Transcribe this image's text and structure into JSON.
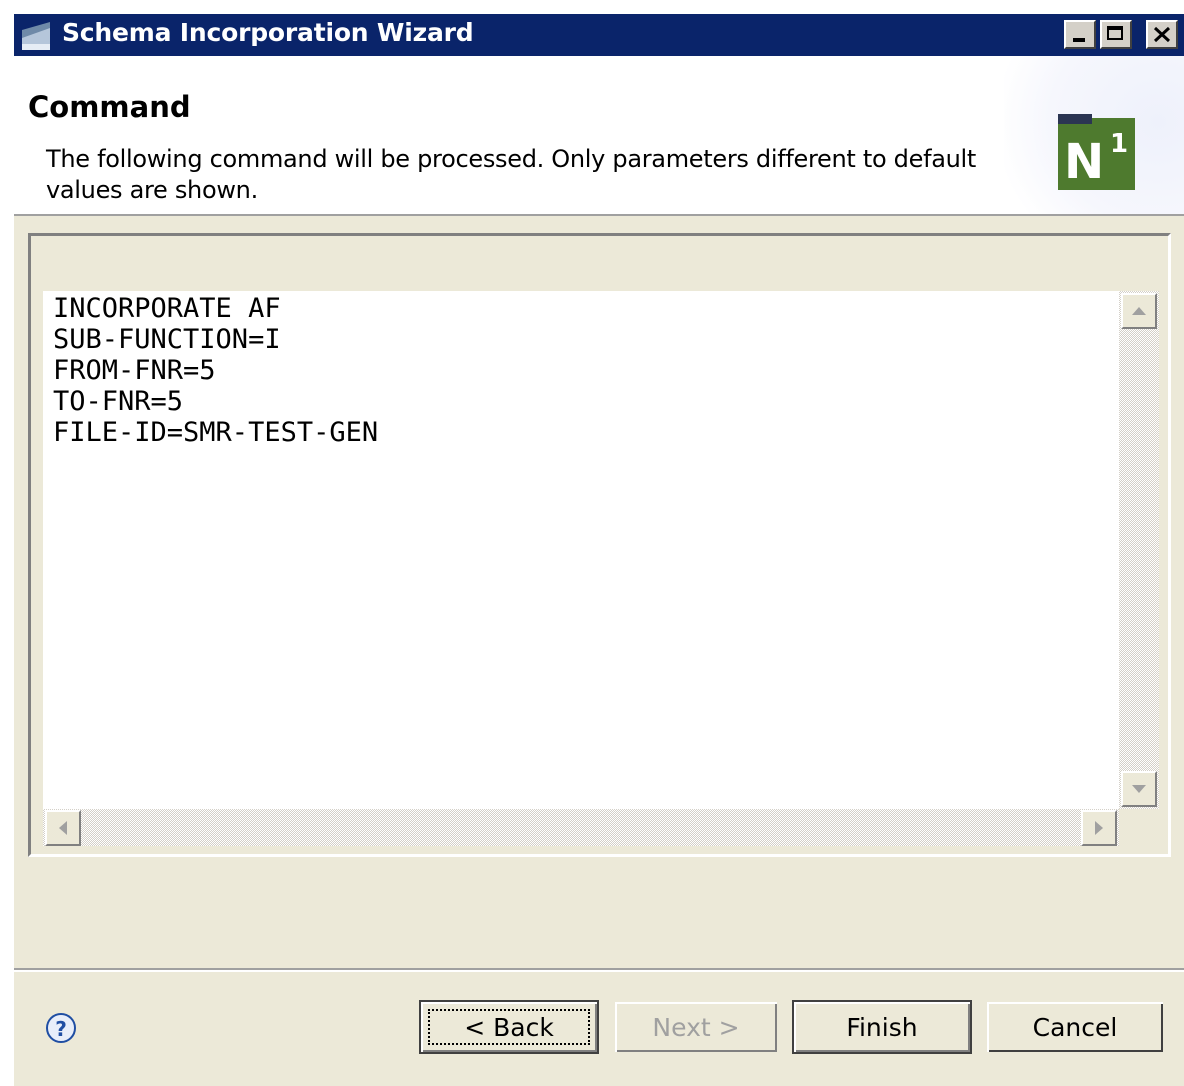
{
  "window": {
    "title": "Schema Incorporation Wizard",
    "controls": {
      "minimize": "minimize",
      "maximize": "maximize",
      "close": "close"
    }
  },
  "header": {
    "title": "Command",
    "description": "The following command will be processed. Only parameters different to default values are shown.",
    "logo_text": "N",
    "logo_superscript": "1"
  },
  "command": {
    "lines": [
      "INCORPORATE AF",
      "SUB-FUNCTION=I",
      "FROM-FNR=5",
      "TO-FNR=5",
      "FILE-ID=SMR-TEST-GEN"
    ]
  },
  "buttons": {
    "back": "< Back",
    "next": "Next >",
    "finish": "Finish",
    "cancel": "Cancel"
  },
  "colors": {
    "titlebar": "#0a246a",
    "logo_green": "#4e7a2e",
    "dialog_bg": "#ece9d8"
  },
  "icons": {
    "help": "help-icon",
    "window": "window-icon"
  }
}
